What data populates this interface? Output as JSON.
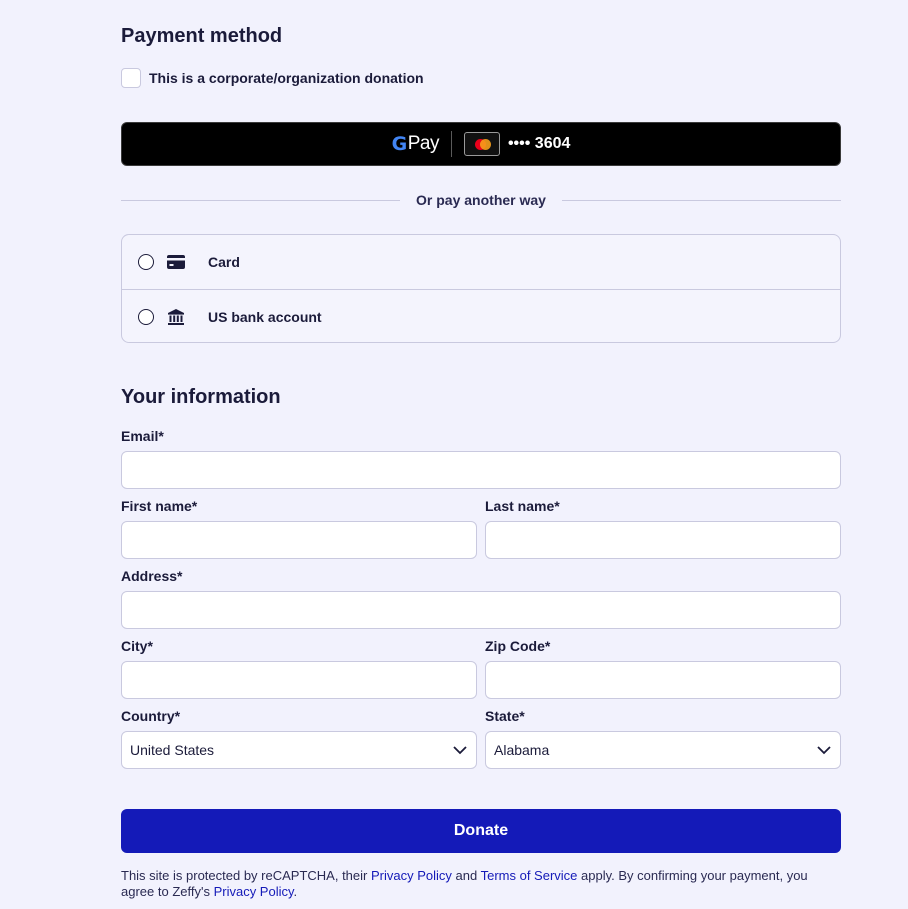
{
  "payment": {
    "title": "Payment method",
    "corporate_label": "This is a corporate/organization donation",
    "gpay": {
      "g_letter": "G",
      "pay_label": "Pay",
      "card_masked": "•••• 3604"
    },
    "divider_text": "Or pay another way",
    "methods": [
      {
        "label": "Card",
        "icon": "credit-card-icon"
      },
      {
        "label": "US bank account",
        "icon": "bank-icon"
      }
    ]
  },
  "info": {
    "title": "Your information",
    "email_label": "Email*",
    "first_name_label": "First name*",
    "last_name_label": "Last name*",
    "address_label": "Address*",
    "city_label": "City*",
    "zip_label": "Zip Code*",
    "country_label": "Country*",
    "country_value": "United States",
    "state_label": "State*",
    "state_value": "Alabama"
  },
  "donate_label": "Donate",
  "legal": {
    "part1": "This site is protected by reCAPTCHA, their ",
    "privacy_link": "Privacy Policy",
    "part2": " and ",
    "terms_link": "Terms of Service",
    "part3": " apply. By confirming your payment, you agree to Zeffy's ",
    "zeffy_privacy_link": "Privacy Policy",
    "part4": "."
  },
  "colors": {
    "background": "#f2f2fd",
    "accent": "#141ab8",
    "text": "#1b1b3a",
    "border": "#c9c9df"
  }
}
